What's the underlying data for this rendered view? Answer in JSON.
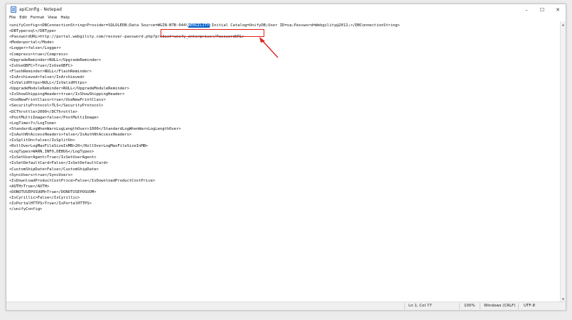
{
  "window": {
    "title": "apiConfig - Notepad",
    "controls": {
      "minimize": "–",
      "maximize": "☐",
      "close": "✕"
    }
  },
  "menu": [
    "File",
    "Edit",
    "Format",
    "View",
    "Help"
  ],
  "editor": {
    "first_line": {
      "before": "<unifyConfig><DBConnectionString>Provider=SQLOLEDB;",
      "boxed_text": "Data Source=WGIN-NTB-044\\",
      "selected_text": "WEBGILITY",
      "after": ";Initial Catalog=UnifyDB;User ID=sa;Password=Webgility@2011;</DBConnectionString>"
    },
    "lines": [
      "<DBType>sql</DBType>",
      "<PasswordURL>http://portal.webgility.com/recover-password.php?product=unify_enterprise</PasswordURL>",
      "<Mode>portal</Mode>",
      "<Logger>false</Logger>",
      "<Compress>true</Compress>",
      "<UpgradeReminder>NULL</UpgradeReminder>",
      "<IsUseQBFC>True</IsUseQBFC>",
      "<FlashReminder>NULL</FlashReminder>",
      "<IsArchieved>false</IsArchieved>",
      "<IsValidHttps>NULL</IsValidHttps>",
      "<UpgradeModuleReminder>NULL</UpgradeModuleReminder>",
      "<IsShowShippingHeader>true</IsShowShippingHeader>",
      "<UseNewPrintClass>true</UseNewPrintClass>",
      "<SecurityProtocol>TLS</SecurityProtocol>",
      "<DCThrottle>2000</DCThrottle>",
      "<PostMultiImage>false</PostMultiImage>",
      "<LogTime>7</LogTime>",
      "<StandardLogWhenWarnLogLengthOver>1000</StandardLogWhenWarnLogLengthOver>",
      "<IsAuthNtAccessHeaders>false</IsAuthNtAccessHeaders>",
      "<IsSplitOn>false</IsSplitOn>",
      "<RollOverLogMaxFileSizeInMB>20</RollOverLogMaxFileSizeInMB>",
      "<LogTypes>WARN,INFO,DEBUG</LogTypes>",
      "<IsSetUserAgent>True</IsSetUserAgent>",
      "<IsSetDefaultCard>False</IsSetDefaultCard>",
      "<CustomShipDate>False</CustomShipDate>",
      "<SyncUsers>true</SyncUsers>",
      "<IsDownloadProductCostPrice>False</IsDownloadProductCostPrice>",
      "<AUTH>True</AUTH>",
      "<DONOTUSEPOSUOM>True</DONOTUSEPOSUOM>",
      "<IsCyrillic>False</IsCyrillic>",
      "<IsPortalHTTPS>True</IsPortalHTTPS>",
      "</unifyConfig>"
    ]
  },
  "status": {
    "position": "Ln 1, Col 77",
    "zoom": "100%",
    "line_ending": "Windows (CRLF)",
    "encoding": "UTF-8"
  },
  "colors": {
    "selection": "#0a63c9",
    "annotation": "#e0201c"
  }
}
